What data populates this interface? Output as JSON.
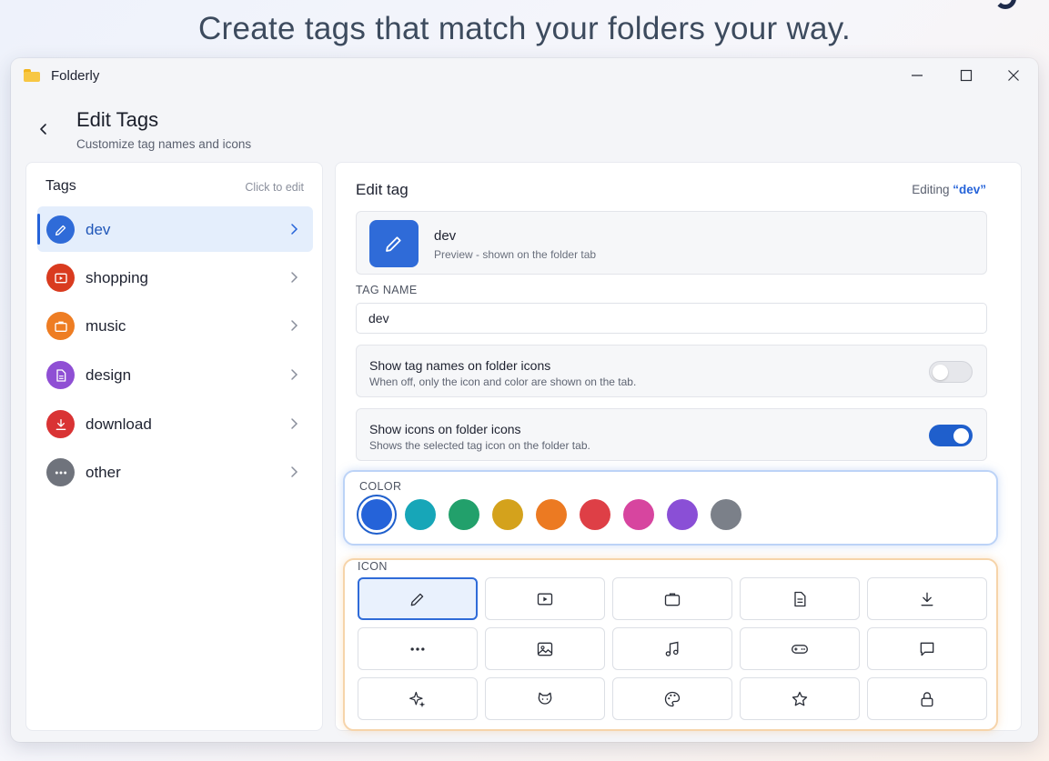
{
  "headline": "Create tags that match your folders your way.",
  "window": {
    "app_title": "Folderly",
    "controls": [
      "minimize-icon",
      "maximize-icon",
      "close-icon"
    ]
  },
  "page": {
    "title": "Edit Tags",
    "subtitle": "Customize tag names and icons"
  },
  "tags_panel": {
    "header": "Tags",
    "hint": "Click to edit",
    "items": [
      {
        "label": "dev",
        "color": "#2f6bd8",
        "icon": "pencil-icon",
        "selected": true
      },
      {
        "label": "shopping",
        "color": "#d93b1f",
        "icon": "video-icon",
        "selected": false
      },
      {
        "label": "music",
        "color": "#ee7d23",
        "icon": "briefcase-icon",
        "selected": false
      },
      {
        "label": "design",
        "color": "#8f4fd4",
        "icon": "document-icon",
        "selected": false
      },
      {
        "label": "download",
        "color": "#d93334",
        "icon": "download-icon",
        "selected": false
      },
      {
        "label": "other",
        "color": "#6f737c",
        "icon": "more-icon",
        "selected": false
      }
    ]
  },
  "edit_panel": {
    "title": "Edit tag",
    "editing_prefix": "Editing",
    "editing_value": "“dev”",
    "preview": {
      "name": "dev",
      "subtitle": "Preview - shown on the folder tab"
    },
    "name_label": "TAG NAME",
    "name_value": "dev",
    "toggles": [
      {
        "title": "Show tag names on folder icons",
        "subtitle": "When off, only the icon and color are shown on the tab.",
        "on": false
      },
      {
        "title": "Show icons on folder icons",
        "subtitle": "Shows the selected tag icon on the folder tab.",
        "on": true
      }
    ],
    "color_label": "COLOR",
    "colors": [
      "#2563d9",
      "#17a6b8",
      "#22a06b",
      "#d4a21c",
      "#ec7a22",
      "#de3f46",
      "#d7459f",
      "#8a4fd6",
      "#7b8089"
    ],
    "selected_color": "#2563d9",
    "icon_label": "ICON",
    "icons": [
      "pencil-icon",
      "video-icon",
      "briefcase-icon",
      "document-icon",
      "download-icon",
      "more-icon",
      "image-icon",
      "music-icon",
      "gamepad-icon",
      "chat-icon",
      "sparkles-icon",
      "cat-icon",
      "palette-icon",
      "star-icon",
      "lock-icon"
    ],
    "selected_icon": "pencil-icon"
  }
}
